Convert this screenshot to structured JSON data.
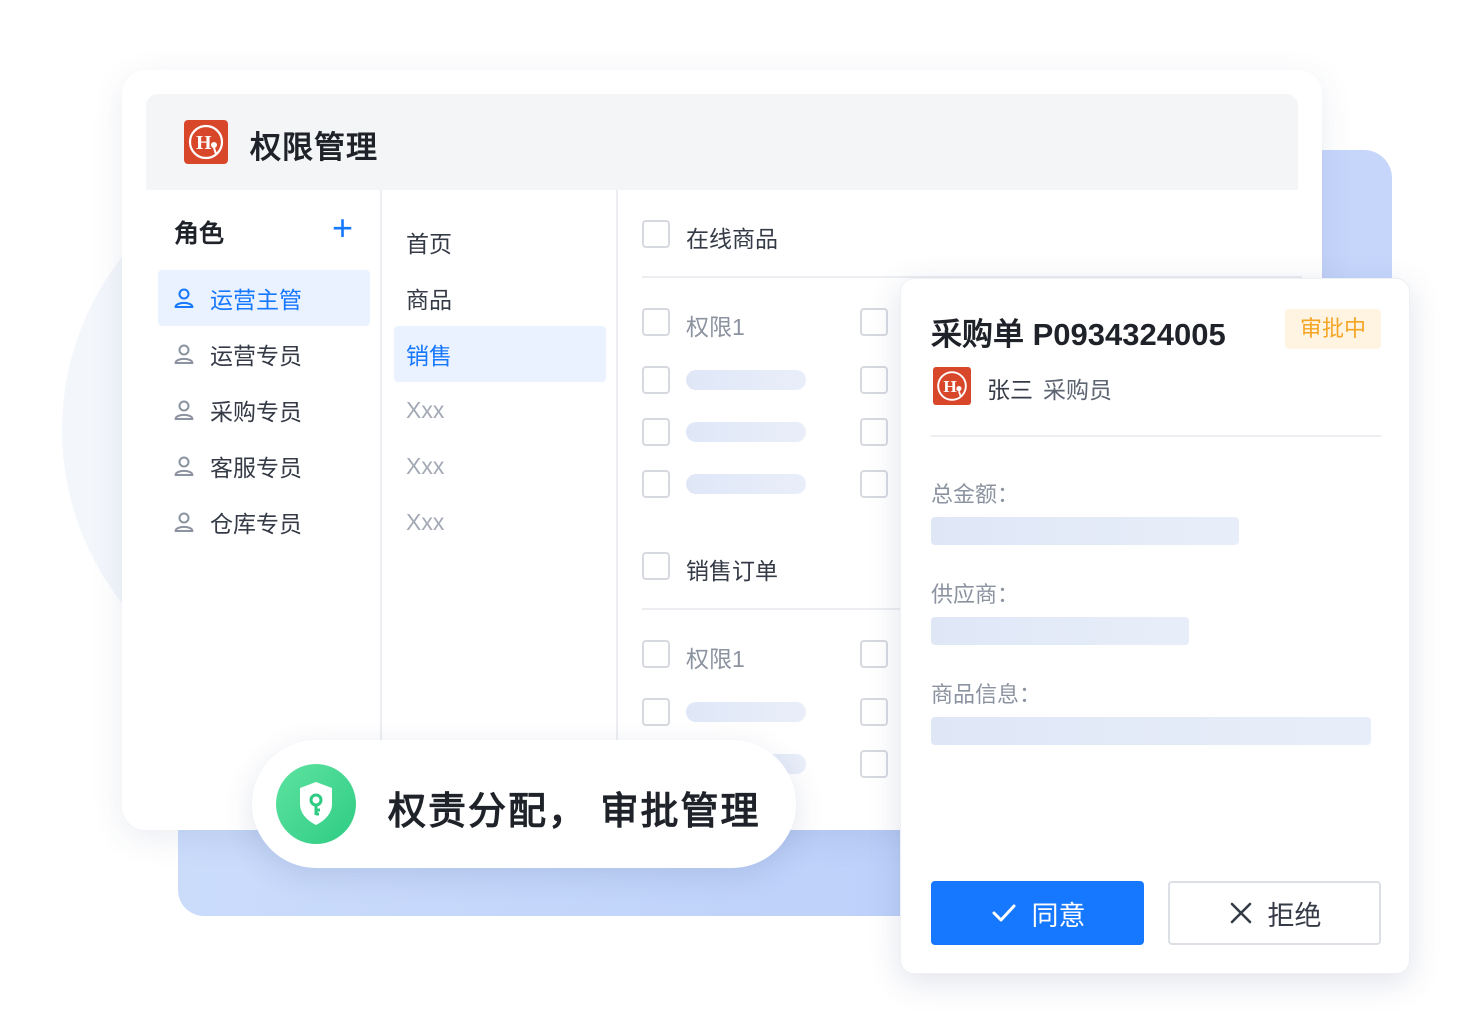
{
  "app": {
    "title": "权限管理",
    "logo_icon": "brand-logo-icon"
  },
  "roles": {
    "heading": "角色",
    "add_label": "+",
    "items": [
      {
        "label": "运营主管",
        "active": true
      },
      {
        "label": "运营专员",
        "active": false
      },
      {
        "label": "采购专员",
        "active": false
      },
      {
        "label": "客服专员",
        "active": false
      },
      {
        "label": "仓库专员",
        "active": false
      }
    ]
  },
  "menu": {
    "items": [
      {
        "label": "首页"
      },
      {
        "label": "商品"
      },
      {
        "label": "销售",
        "active": true
      },
      {
        "label": "Xxx"
      },
      {
        "label": "Xxx"
      },
      {
        "label": "Xxx"
      }
    ]
  },
  "permissions": {
    "groups": [
      {
        "label": "在线商品",
        "items": [
          {
            "label": "权限1"
          }
        ]
      },
      {
        "label": "销售订单",
        "items": [
          {
            "label": "权限1"
          }
        ]
      }
    ]
  },
  "badge": {
    "text": "权责分配， 审批管理",
    "icon": "shield-key-icon"
  },
  "order": {
    "title": "采购单 P0934324005",
    "status": "审批中",
    "applicant_name": "张三",
    "applicant_role": "采购员",
    "fields": [
      {
        "label": "总金额："
      },
      {
        "label": "供应商："
      },
      {
        "label": "商品信息："
      }
    ],
    "approve_label": "同意",
    "reject_label": "拒绝"
  },
  "colors": {
    "accent": "#1677ff",
    "status_pending": "#f5a524",
    "brand": "#d9472b",
    "success": "#2ecc83"
  }
}
